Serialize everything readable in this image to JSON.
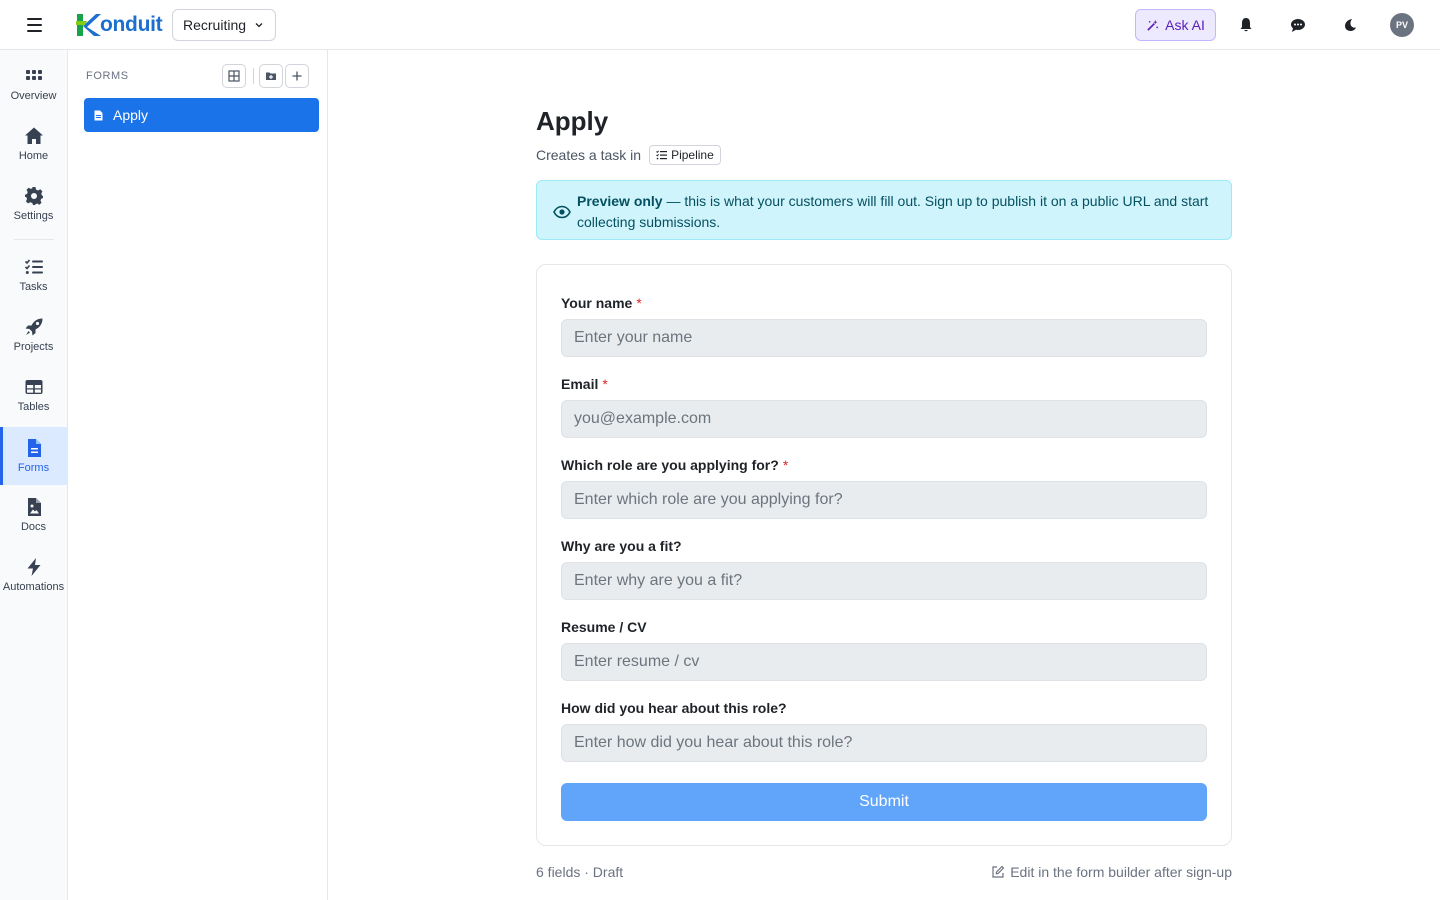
{
  "header": {
    "app_name": "onduit",
    "workspace": "Recruiting",
    "ask_ai_label": "Ask AI",
    "avatar_initials": "PV"
  },
  "rail": {
    "items": [
      {
        "label": "Overview",
        "icon": "grid-icon"
      },
      {
        "label": "Home",
        "icon": "home-icon"
      },
      {
        "label": "Settings",
        "icon": "gear-icon"
      },
      {
        "label": "Tasks",
        "icon": "checklist-icon"
      },
      {
        "label": "Projects",
        "icon": "rocket-icon"
      },
      {
        "label": "Tables",
        "icon": "table-icon"
      },
      {
        "label": "Forms",
        "icon": "file-icon",
        "active": true
      },
      {
        "label": "Docs",
        "icon": "doc-image-icon"
      },
      {
        "label": "Automations",
        "icon": "bolt-icon"
      }
    ]
  },
  "panel": {
    "heading": "FORMS",
    "forms": [
      {
        "label": "Apply",
        "active": true
      }
    ]
  },
  "main": {
    "title": "Apply",
    "subtitle_prefix": "Creates a task in",
    "pipeline_label": "Pipeline",
    "notice_bold": "Preview only",
    "notice_text": " — this is what your customers will fill out. Sign up to publish it on a public URL and start collecting submissions.",
    "fields": [
      {
        "label": "Your name",
        "required": "*",
        "placeholder": "Enter your name"
      },
      {
        "label": "Email",
        "required": "*",
        "placeholder": "you@example.com"
      },
      {
        "label": "Which role are you applying for?",
        "required": "*",
        "placeholder": "Enter which role are you applying for?"
      },
      {
        "label": "Why are you a fit?",
        "required": "",
        "placeholder": "Enter why are you a fit?"
      },
      {
        "label": "Resume / CV",
        "required": "",
        "placeholder": "Enter resume / cv"
      },
      {
        "label": "How did you hear about this role?",
        "required": "",
        "placeholder": "Enter how did you hear about this role?"
      }
    ],
    "submit_label": "Submit",
    "footer_meta": "6 fields · Draft",
    "footer_edit": "Edit in the form builder after sign-up"
  },
  "colors": {
    "accent": "#1a73e8",
    "submit": "#60a5fa",
    "notice_bg": "#cff4fc",
    "ask_ai_bg": "#ede9fe",
    "required": "#dc2626"
  }
}
